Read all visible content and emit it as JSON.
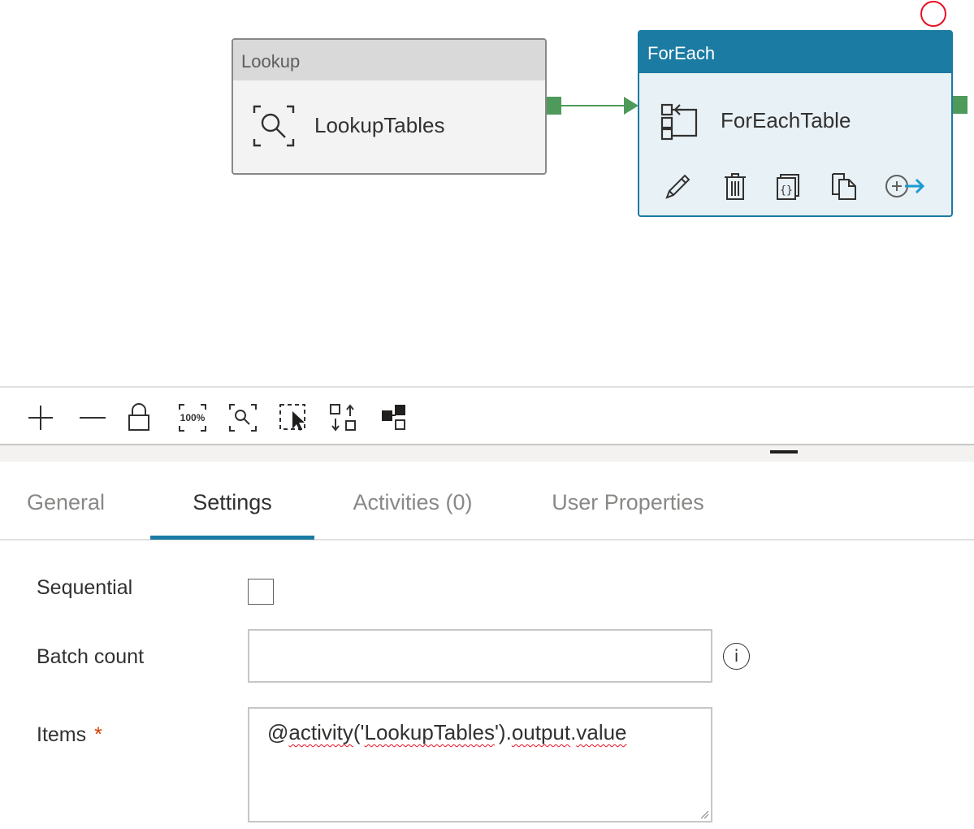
{
  "canvas": {
    "lookup_node": {
      "type_label": "Lookup",
      "name": "LookupTables"
    },
    "foreach_node": {
      "type_label": "ForEach",
      "name": "ForEachTable",
      "actions": [
        "edit-icon",
        "delete-icon",
        "code-icon",
        "copy-icon",
        "add-activity-icon"
      ]
    },
    "colors": {
      "foreach_accent": "#1b7ba2",
      "success_port": "#4e9a5b",
      "error_indicator": "#e81123",
      "required_mark": "#d83b01"
    }
  },
  "toolbar": {
    "buttons": [
      "zoom-in-icon",
      "zoom-out-icon",
      "lock-icon",
      "zoom-100-icon",
      "zoom-to-fit-icon",
      "select-icon",
      "auto-align-icon",
      "layout-icon"
    ],
    "zoom_100_label": "100%"
  },
  "tabs": [
    {
      "label": "General",
      "active": false
    },
    {
      "label": "Settings",
      "active": true
    },
    {
      "label": "Activities (0)",
      "active": false
    },
    {
      "label": "User Properties",
      "active": false
    }
  ],
  "settings": {
    "sequential_label": "Sequential",
    "sequential_checked": false,
    "batch_count_label": "Batch count",
    "batch_count_value": "",
    "info_glyph": "i",
    "items_label": "Items",
    "items_required": "*",
    "items_expression": {
      "prefix": "@",
      "fn": "activity",
      "open": "('",
      "arg": "LookupTables",
      "close": "').",
      "prop1": "output",
      "dot": ".",
      "prop2": "value"
    }
  }
}
